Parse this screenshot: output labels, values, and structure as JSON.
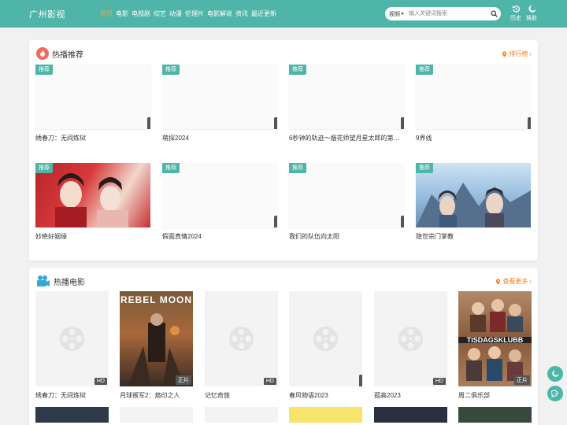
{
  "header": {
    "logo": "广州影视",
    "nav": [
      "首页",
      "电影",
      "电视剧",
      "综艺",
      "动漫",
      "伦理片",
      "电影解说",
      "资讯",
      "最近更新"
    ],
    "search": {
      "type": "视频",
      "placeholder": "输入关键词搜索"
    },
    "history_label": "历史",
    "theme_label": "换肤"
  },
  "hot": {
    "title": "热播推荐",
    "more": "排行榜",
    "badge": "推荐",
    "items": [
      {
        "title": "绣春刀：无间炼狱"
      },
      {
        "title": "萌探2024"
      },
      {
        "title": "6秒钟的轨迹～烟花师望月星太郎的第…"
      },
      {
        "title": "9界线"
      },
      {
        "title": "妙绝好姻缘"
      },
      {
        "title": "假面真情2024"
      },
      {
        "title": "我们的队伍向太阳"
      },
      {
        "title": "隐世宗门掌教"
      }
    ]
  },
  "movies": {
    "title": "热播电影",
    "more": "查看更多",
    "items": [
      {
        "title": "绣春刀：无间炼狱",
        "quality": "HD"
      },
      {
        "title": "月球叛军2：烙印之人",
        "quality": "正片",
        "poster_text": "REBEL MOON"
      },
      {
        "title": "记忆奇旅",
        "quality": "HD"
      },
      {
        "title": "春风物语2023",
        "quality": ""
      },
      {
        "title": "孤高2023",
        "quality": "HD"
      },
      {
        "title": "周二俱乐部",
        "quality": "正片",
        "poster_text": "TISDAGSKLUBB"
      }
    ]
  },
  "colors": {
    "accent": "#4fb5a8",
    "highlight": "#ff7a1a"
  }
}
